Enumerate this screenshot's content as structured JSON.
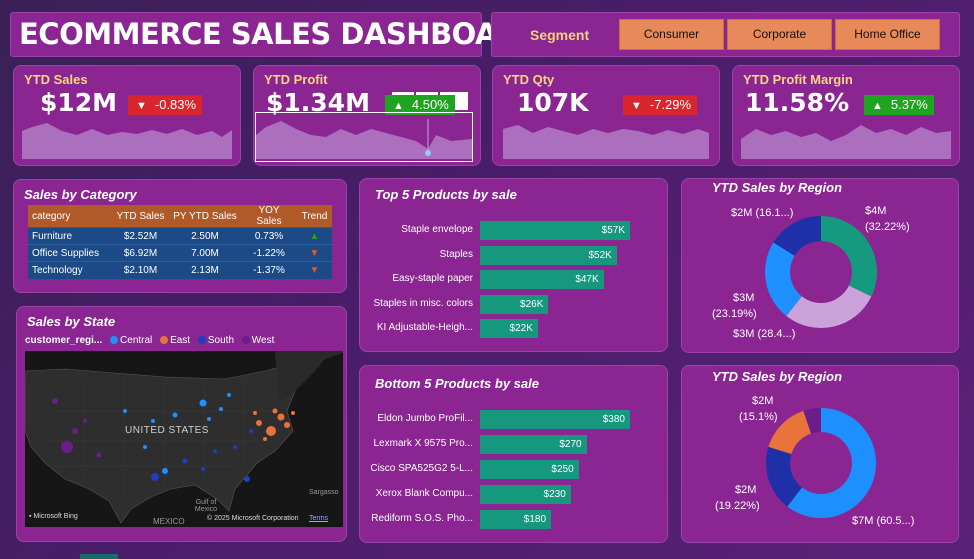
{
  "header": {
    "title": "ECOMMERCE SALES DASHBOARD"
  },
  "segment": {
    "label": "Segment",
    "options": [
      "Consumer",
      "Corporate",
      "Home Office"
    ]
  },
  "kpis": {
    "ytd_sales": {
      "title": "YTD Sales",
      "value": "$12M",
      "change": "-0.83%",
      "direction": "down"
    },
    "ytd_profit": {
      "title": "YTD Profit",
      "value": "$1.34M",
      "change": "4.50%",
      "direction": "up"
    },
    "ytd_qty": {
      "title": "YTD Qty",
      "value": "107K",
      "change": "-7.29%",
      "direction": "down"
    },
    "ytd_margin": {
      "title": "YTD Profit Margin",
      "value": "11.58%",
      "change": "5.37%",
      "direction": "up"
    }
  },
  "sales_by_category": {
    "title": "Sales by Category",
    "columns": [
      "category",
      "YTD Sales",
      "PY YTD Sales",
      "YOY Sales",
      "Trend"
    ],
    "rows": [
      {
        "category": "Furniture",
        "ytd": "$2.52M",
        "py": "2.50M",
        "yoy": "0.73%",
        "trend": "up"
      },
      {
        "category": "Office Supplies",
        "ytd": "$6.92M",
        "py": "7.00M",
        "yoy": "-1.22%",
        "trend": "down"
      },
      {
        "category": "Technology",
        "ytd": "$2.10M",
        "py": "2.13M",
        "yoy": "-1.37%",
        "trend": "down"
      }
    ]
  },
  "sales_by_state": {
    "title": "Sales by State",
    "legend_label": "customer_regi...",
    "legend": [
      {
        "name": "Central",
        "color": "#1e90ff"
      },
      {
        "name": "East",
        "color": "#e8743b"
      },
      {
        "name": "South",
        "color": "#1f3fbf"
      },
      {
        "name": "West",
        "color": "#6b1d8a"
      }
    ],
    "map_labels": {
      "country": "UNITED STATES",
      "gulf": "Gulf of Mexico",
      "mexico": "MEXICO",
      "sargasso": "Sargasso",
      "bing": "Microsoft Bing",
      "copyright": "© 2025 Microsoft Corporation",
      "terms": "Terms"
    }
  },
  "top5": {
    "title": "Top 5 Products by sale",
    "items": [
      {
        "label": "Staple envelope",
        "value": 57,
        "display": "$57K"
      },
      {
        "label": "Staples",
        "value": 52,
        "display": "$52K"
      },
      {
        "label": "Easy-staple paper",
        "value": 47,
        "display": "$47K"
      },
      {
        "label": "Staples in misc. colors",
        "value": 26,
        "display": "$26K"
      },
      {
        "label": "KI Adjustable-Heigh...",
        "value": 22,
        "display": "$22K"
      }
    ]
  },
  "bottom5": {
    "title": "Bottom 5 Products by sale",
    "items": [
      {
        "label": "Eldon Jumbo ProFil...",
        "value": 380,
        "display": "$380"
      },
      {
        "label": "Lexmark X 9575 Pro...",
        "value": 270,
        "display": "$270"
      },
      {
        "label": "Cisco SPA525G2 5-L...",
        "value": 250,
        "display": "$250"
      },
      {
        "label": "Xerox Blank Compu...",
        "value": 230,
        "display": "$230"
      },
      {
        "label": "Rediform S.O.S. Pho...",
        "value": 180,
        "display": "$180"
      }
    ]
  },
  "region1": {
    "title": "YTD Sales by Region",
    "labels": [
      "$4M",
      "(32.22%)",
      "$3M (28.4...)",
      "$3M",
      "(23.19%)",
      "$2M (16.1...)"
    ],
    "slices": [
      {
        "percent": 32.22,
        "color": "#159a7f"
      },
      {
        "percent": 28.4,
        "color": "#c9a3d9"
      },
      {
        "percent": 23.19,
        "color": "#1e90ff"
      },
      {
        "percent": 16.19,
        "color": "#1f2fa8"
      }
    ]
  },
  "region2": {
    "title": "YTD Sales by Region",
    "labels": [
      "$2M",
      "(15.1%)",
      "$2M",
      "(19.22%)",
      "$7M (60.5...)"
    ],
    "slices": [
      {
        "percent": 60.5,
        "color": "#1e8fff"
      },
      {
        "percent": 19.22,
        "color": "#1f2fa8"
      },
      {
        "percent": 15.1,
        "color": "#e8743b"
      },
      {
        "percent": 5.18,
        "color": "#6b1d8a"
      }
    ]
  },
  "colors": {
    "panel": "#8a2592",
    "accent": "#f5d77d",
    "bar": "#15987e",
    "down": "#d9262e",
    "up": "#1ea41e"
  }
}
